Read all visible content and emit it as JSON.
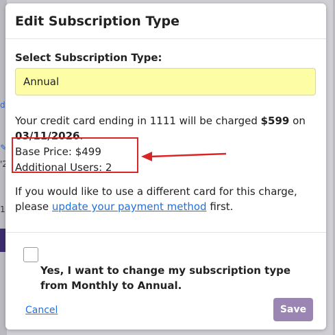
{
  "background": {
    "link_fragment": "de",
    "icon_fragment": "✎",
    "fragment_7": "'2",
    "fragment_1": "11"
  },
  "modal": {
    "title": "Edit Subscription Type",
    "select_label": "Select Subscription Type:",
    "select_value": "Annual",
    "charge_prefix": "Your credit card ending in 1111 will be charged ",
    "charge_amount": "$599",
    "charge_on": " on",
    "charge_date": "03/11/2026",
    "charge_suffix": ".",
    "base_price": "Base Price: $499",
    "additional_users": "Additional Users: 2",
    "card_note_prefix": "If you would like to use a different card for this charge, please ",
    "card_note_link": "update your payment method",
    "card_note_suffix": " first.",
    "confirm_text": "Yes, I want to change my subscription type from Monthly to Annual.",
    "cancel_label": "Cancel",
    "save_label": "Save"
  },
  "colors": {
    "select_bg": "#fdfda6",
    "highlight_box": "#d92525",
    "link": "#1f6fe0",
    "save_button": "#9b86b3"
  }
}
